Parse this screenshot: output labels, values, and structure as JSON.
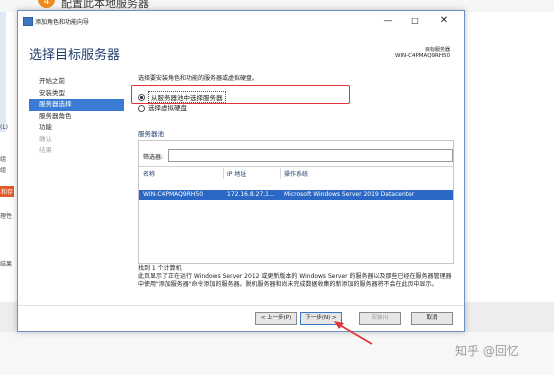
{
  "background": {
    "step_badge": "4",
    "heading": "配置此本地服务器",
    "left_fragments": [
      "(L)",
      "组",
      "组",
      "和存",
      "理性",
      "结果"
    ],
    "watermark": "知乎 @回忆"
  },
  "dialog": {
    "app_title": "添加角色和功能向导",
    "controls": {
      "minimize": "—",
      "maximize": "□",
      "close": "✕"
    },
    "page_title": "选择目标服务器",
    "destination_label": "目标服务器",
    "destination_value": "WIN-C4PMAQ9RH50",
    "nav": [
      {
        "label": "开始之前",
        "state": "normal"
      },
      {
        "label": "安装类型",
        "state": "normal"
      },
      {
        "label": "服务器选择",
        "state": "active"
      },
      {
        "label": "服务器角色",
        "state": "normal"
      },
      {
        "label": "功能",
        "state": "normal"
      },
      {
        "label": "确认",
        "state": "disabled"
      },
      {
        "label": "结果",
        "state": "disabled"
      }
    ],
    "instruction": "选择要安装角色和功能的服务器或虚拟硬盘。",
    "options": [
      {
        "label": "从服务器池中选择服务器",
        "checked": true
      },
      {
        "label": "选择虚拟硬盘",
        "checked": false
      }
    ],
    "pool_label": "服务器池",
    "filter_label": "筛选器:",
    "filter_value": "",
    "columns": [
      "名称",
      "IP 地址",
      "操作系统"
    ],
    "rows": [
      {
        "name": "WIN-C4PMAQ9RH50",
        "ip": "172.16.8.27,1...",
        "os": "Microsoft Windows Server 2019 Datacenter",
        "selected": true
      }
    ],
    "found_text": "找到 1 个计算机",
    "description": "此页显示了正在运行 Windows Server 2012 或更新版本的 Windows Server 的服务器以及那些已经在服务器管理器中使用\"添加服务器\"命令添加的服务器。脱机服务器和尚未完成数据收集的新添加的服务器将不会在此页中显示。",
    "buttons": {
      "prev": "< 上一步(P)",
      "next": "下一步(N) >",
      "install": "安装(I)",
      "cancel": "取消"
    }
  },
  "colors": {
    "accent": "#3a7bd5",
    "selection": "#2b68c5",
    "highlight_border": "#e0343a",
    "badge": "#f08a1c"
  }
}
